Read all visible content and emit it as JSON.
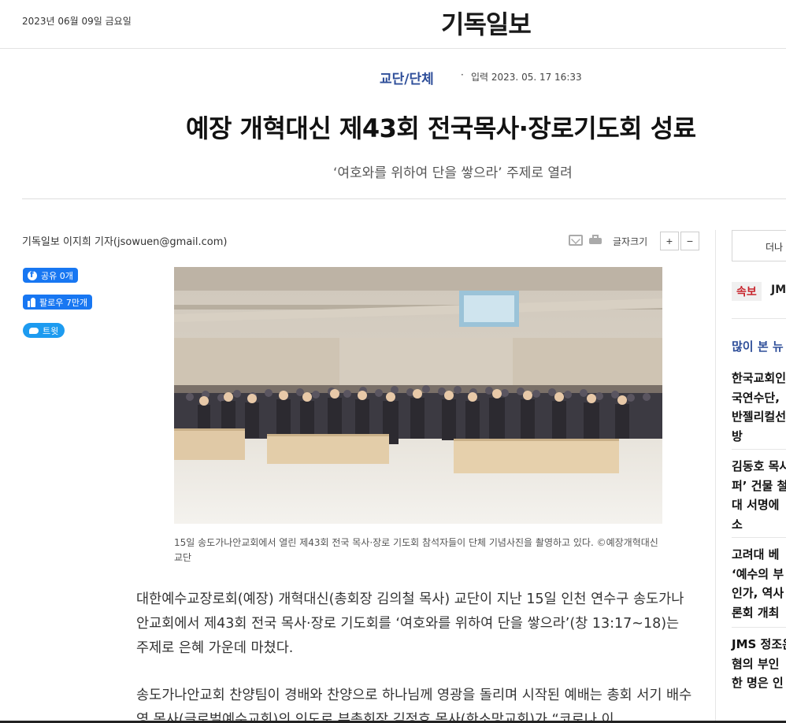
{
  "header": {
    "date": "2023년 06월 09일 금요일",
    "logo": "기독일보"
  },
  "article": {
    "section": "교단/단체",
    "published": "입력 2023. 05. 17 16:33",
    "headline": "예장 개혁대신 제43회 전국목사·장로기도회 성료",
    "subhead": "‘여호와를 위하여 단을 쌓으라’ 주제로 열려",
    "byline": "기독일보 이지희 기자(jsowuen@gmail.com)",
    "caption": "15일 송도가나안교회에서 열린 제43회 전국 목사·장로 기도회 참석자들이 단체 기념사진을 촬영하고 있다. ©예장개혁대신 교단",
    "paragraphs": [
      "대한예수교장로회(예장) 개혁대신(총회장 김의철 목사) 교단이 지난 15일 인천 연수구 송도가나안교회에서 제43회 전국 목사·장로 기도회를 ‘여호와를 위하여 단을 쌓으라’(창 13:17~18)는 주제로 은혜 가운데 마쳤다.",
      "송도가나안교회 찬양팀이 경배와 찬양으로 하나님께 영광을 돌리며 시작된 예배는 총회 서기 배수영 목사(글로벌예수교회)의 인도로 부총회장 김정호 목사(한소망교회)가 “코로나 이"
    ]
  },
  "tools": {
    "fontsize_label": "글자크기",
    "plus": "+",
    "minus": "−"
  },
  "social": {
    "fb_share": "공유 0개",
    "fb_follow": "팔로우 7만개",
    "tweet": "트윗"
  },
  "sidebar": {
    "more": "더나",
    "breaking_label": "속보",
    "breaking_text": "JMS",
    "popular_title": "많이 본 뉴",
    "popular": [
      [
        "한국교회인",
        "국연수단,",
        "반젤리컬선",
        "방"
      ],
      [
        "김동호 목사",
        "퍼’ 건물 철",
        "대 서명에",
        "소"
      ],
      [
        "고려대 베",
        "‘예수의 부",
        "인가, 역사",
        "론회 개최"
      ],
      [
        "JMS 정조은",
        "혐의 부인",
        "한 명은 인"
      ]
    ]
  },
  "colors": {
    "accent": "#2f4f9a",
    "breaking": "#c8262e",
    "facebook": "#1877f2",
    "twitter": "#1d9bf0"
  }
}
